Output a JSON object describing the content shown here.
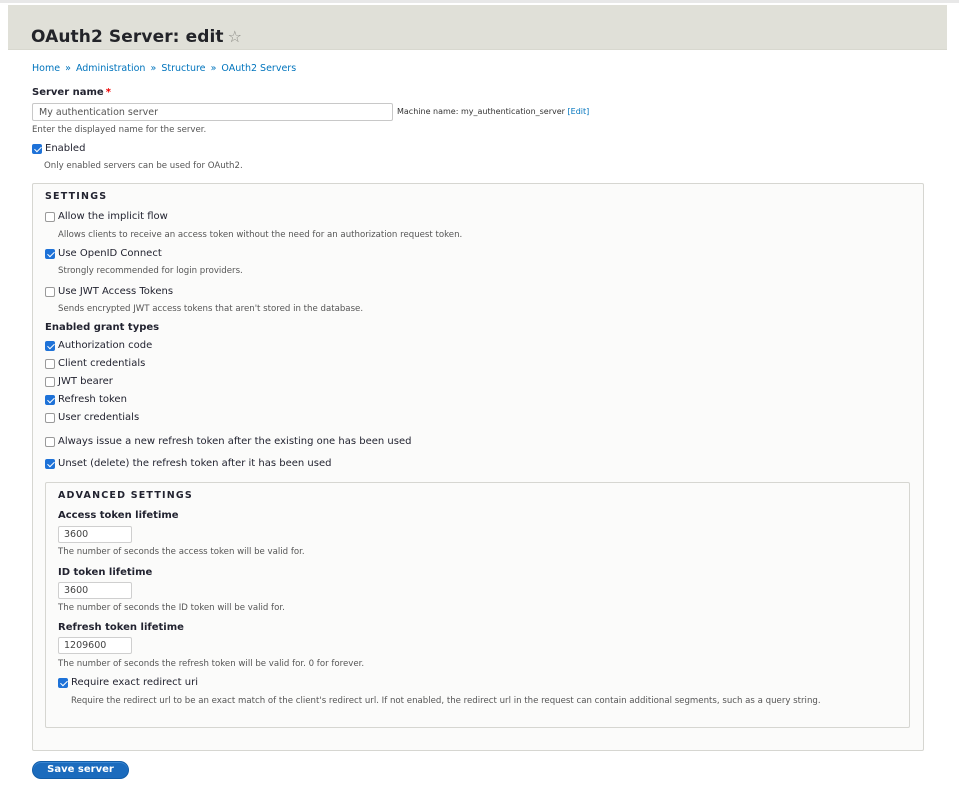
{
  "page": {
    "title": "OAuth2 Server: edit",
    "favorite_icon": "star-outline-icon"
  },
  "breadcrumb": {
    "separator": "»",
    "items": [
      {
        "label": "Home"
      },
      {
        "label": "Administration"
      },
      {
        "label": "Structure"
      },
      {
        "label": "OAuth2 Servers"
      }
    ]
  },
  "server_name": {
    "label": "Server name",
    "required_marker": "*",
    "value": "My authentication server",
    "machine_name_prefix": "Machine name: my_authentication_server",
    "machine_name_edit": "[Edit]",
    "description": "Enter the displayed name for the server."
  },
  "enabled": {
    "label": "Enabled",
    "checked": true,
    "description": "Only enabled servers can be used for OAuth2."
  },
  "settings": {
    "legend": "SETTINGS",
    "implicit_flow": {
      "label": "Allow the implicit flow",
      "checked": false,
      "description": "Allows clients to receive an access token without the need for an authorization request token."
    },
    "openid_connect": {
      "label": "Use OpenID Connect",
      "checked": true,
      "description": "Strongly recommended for login providers."
    },
    "jwt_access_tokens": {
      "label": "Use JWT Access Tokens",
      "checked": false,
      "description": "Sends encrypted JWT access tokens that aren't stored in the database."
    },
    "grant_types": {
      "label": "Enabled grant types",
      "items": [
        {
          "label": "Authorization code",
          "checked": true
        },
        {
          "label": "Client credentials",
          "checked": false
        },
        {
          "label": "JWT bearer",
          "checked": false
        },
        {
          "label": "Refresh token",
          "checked": true
        },
        {
          "label": "User credentials",
          "checked": false
        }
      ]
    },
    "always_issue_refresh": {
      "label": "Always issue a new refresh token after the existing one has been used",
      "checked": false
    },
    "unset_refresh": {
      "label": "Unset (delete) the refresh token after it has been used",
      "checked": true
    },
    "advanced": {
      "legend": "ADVANCED SETTINGS",
      "access_token_lifetime": {
        "label": "Access token lifetime",
        "value": "3600",
        "description": "The number of seconds the access token will be valid for."
      },
      "id_token_lifetime": {
        "label": "ID token lifetime",
        "value": "3600",
        "description": "The number of seconds the ID token will be valid for."
      },
      "refresh_token_lifetime": {
        "label": "Refresh token lifetime",
        "value": "1209600",
        "description": "The number of seconds the refresh token will be valid for. 0 for forever."
      },
      "require_exact_redirect": {
        "label": "Require exact redirect uri",
        "checked": true,
        "description": "Require the redirect url to be an exact match of the client's redirect url. If not enabled, the redirect url in the request can contain additional segments, such as a query string."
      }
    }
  },
  "actions": {
    "save_label": "Save server"
  },
  "colors": {
    "accent": "#0074bd",
    "button": "#1b6bbd",
    "header_bg": "#e0e0d8",
    "required": "#ee0000"
  }
}
